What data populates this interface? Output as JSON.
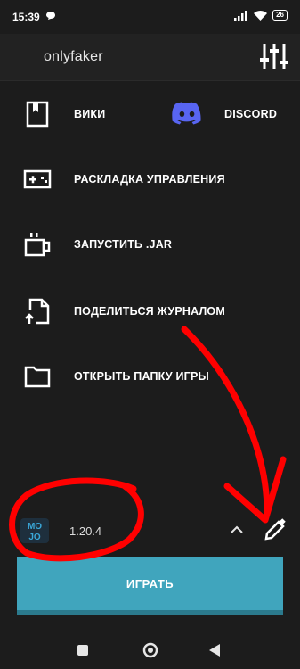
{
  "status_bar": {
    "time": "15:39",
    "battery": "26",
    "icons": [
      "chat-bubble-icon",
      "signal-icon",
      "wifi-icon",
      "battery-icon"
    ]
  },
  "header": {
    "profile_name": "onlyfaker",
    "settings_icon": "sliders-icon"
  },
  "menu": {
    "wiki": "ВИКИ",
    "discord": "DISCORD",
    "controls": "РАСКЛАДКА УПРАВЛЕНИЯ",
    "run_jar": "ЗАПУСТИТЬ .JAR",
    "share_log": "ПОДЕЛИТЬСЯ ЖУРНАЛОМ",
    "open_folder": "ОТКРЫТЬ ПАПКУ ИГРЫ"
  },
  "version": {
    "selected": "1.20.4"
  },
  "play_button": "ИГРАТЬ",
  "colors": {
    "background": "#1c1c1c",
    "header": "#222222",
    "play": "#40a5bd",
    "discord": "#5865f2",
    "annotation": "#ff0000"
  }
}
